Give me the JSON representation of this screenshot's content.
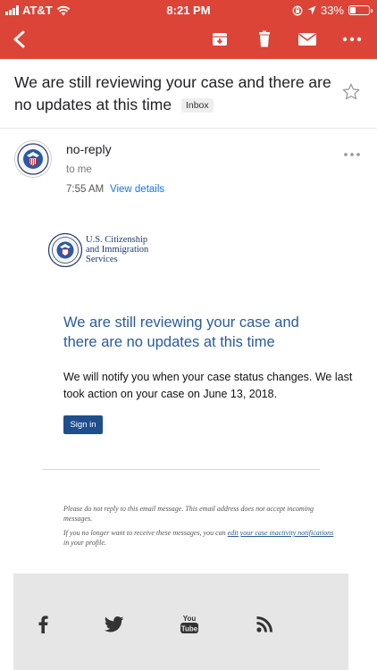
{
  "status_bar": {
    "carrier": "AT&T",
    "time": "8:21 PM",
    "battery_percent": "33%",
    "battery_level": 0.33,
    "icons": [
      "signal-icon",
      "wifi-icon",
      "orientation-lock-icon",
      "location-icon",
      "battery-icon"
    ]
  },
  "toolbar": {
    "icons": [
      "back-arrow-icon",
      "archive-icon",
      "delete-icon",
      "mark-unread-icon",
      "more-vert-icon"
    ],
    "accent_color": "#db4437"
  },
  "email": {
    "subject": "We are still reviewing your case and there are no updates at this time",
    "label": "Inbox",
    "sender": "no-reply",
    "recipient": "to me",
    "time": "7:55 AM",
    "view_details": "View details"
  },
  "body": {
    "org_line1": "U.S. Citizenship",
    "org_line2": "and Immigration",
    "org_line3": "Services",
    "headline": "We are still reviewing your case and there are no updates at this time",
    "paragraph": "We will notify you when your case status changes. We last took action on your case on June 13, 2018.",
    "button": "Sign in",
    "disclaimer": "Please do not reply to this email message. This email address does not accept incoming messages.",
    "unsubscribe_prefix": "If you no longer want to receive these messages, you can ",
    "unsubscribe_link": "edit your case inactivity notifications",
    "unsubscribe_suffix": " in your profile.",
    "headline_color": "#2a5b97",
    "button_color": "#1f4e8c"
  },
  "footer": {
    "social_icons": [
      "facebook-icon",
      "twitter-icon",
      "youtube-icon",
      "rss-icon"
    ],
    "youtube_text_top": "You",
    "youtube_text_bottom": "Tube"
  }
}
